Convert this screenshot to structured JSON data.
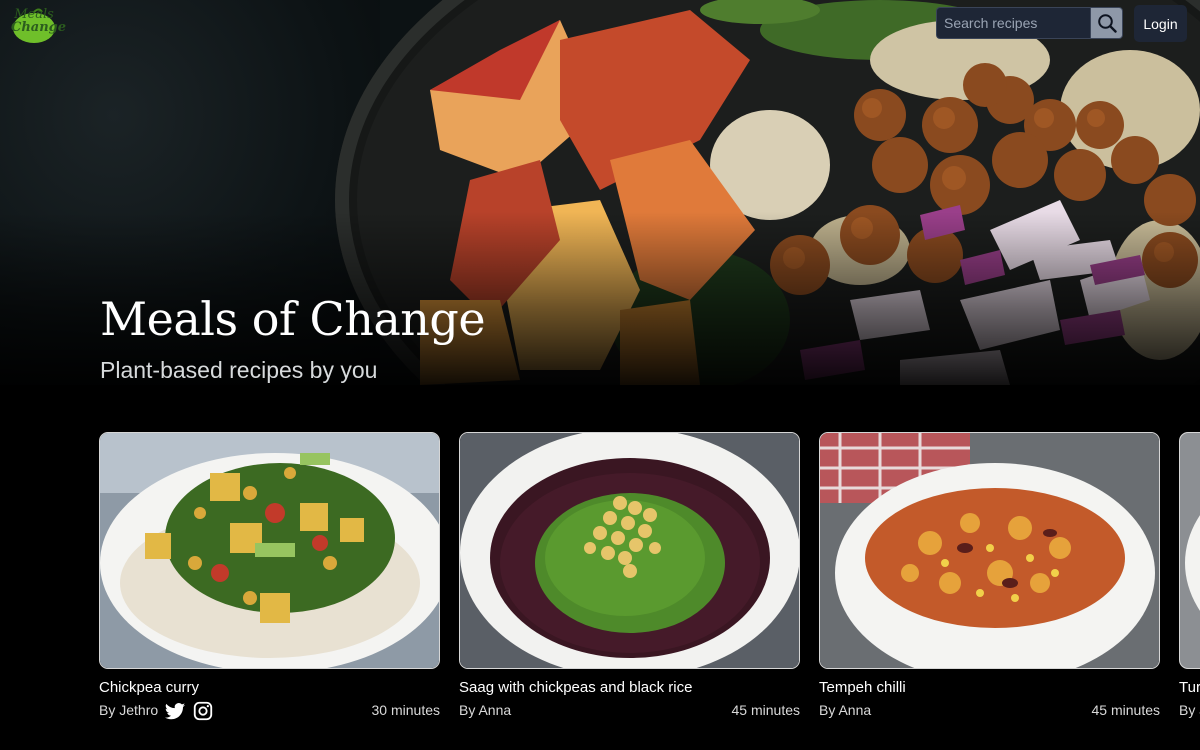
{
  "header": {
    "logo_lines": [
      "Meals",
      "Change"
    ],
    "search": {
      "placeholder": "Search recipes"
    },
    "login_label": "Login"
  },
  "hero": {
    "title": "Meals of Change",
    "subtitle": "Plant-based recipes by you"
  },
  "recipes": [
    {
      "title": "Chickpea curry",
      "author": "By Jethro",
      "time": "30 minutes",
      "social": [
        "twitter-icon",
        "instagram-icon"
      ]
    },
    {
      "title": "Saag with chickpeas and black rice",
      "author": "By Anna",
      "time": "45 minutes",
      "social": []
    },
    {
      "title": "Tempeh chilli",
      "author": "By Anna",
      "time": "45 minutes",
      "social": []
    },
    {
      "title": "Tur",
      "author": "By J",
      "time": "",
      "social": []
    }
  ],
  "colors": {
    "background": "#000000",
    "button_bg": "#1e2636",
    "logo_green": "#6fbf2a"
  }
}
